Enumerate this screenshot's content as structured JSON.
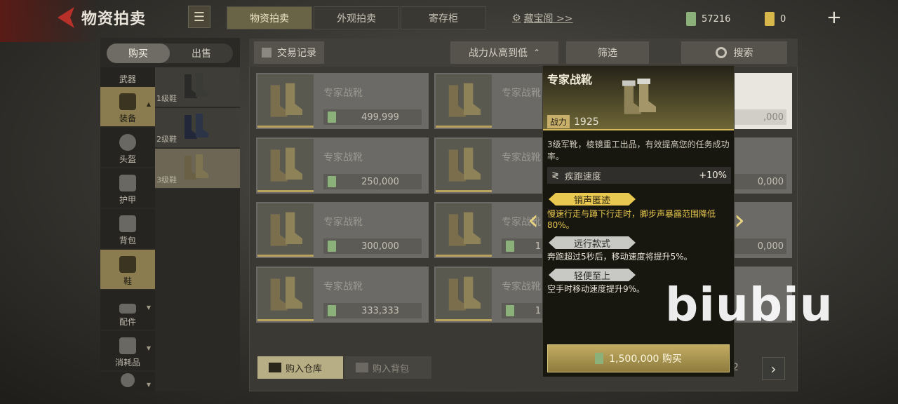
{
  "header": {
    "title": "物资拍卖",
    "tabs": [
      "物资拍卖",
      "外观拍卖",
      "寄存柜"
    ],
    "active_tab": 0,
    "treasure_link": "藏宝阁 >>",
    "currency_green": "57216",
    "currency_gold": "0",
    "plus": "+"
  },
  "sidebar": {
    "segment": [
      "购买",
      "出售"
    ],
    "categories": [
      {
        "label": "武器",
        "icon": "rifle-icon"
      },
      {
        "label": "装备",
        "icon": "vest-icon",
        "expand": "▲"
      },
      {
        "label": "头盔",
        "icon": "helmet-icon"
      },
      {
        "label": "护甲",
        "icon": "armor-icon"
      },
      {
        "label": "背包",
        "icon": "backpack-icon"
      },
      {
        "label": "鞋",
        "icon": "boot-icon"
      },
      {
        "label": "配件",
        "icon": "attachment-icon",
        "expand": "▼"
      },
      {
        "label": "消耗品",
        "icon": "consumable-icon",
        "expand": "▼"
      },
      {
        "label": "",
        "icon": "gear-icon",
        "expand": "▼"
      }
    ],
    "subitems": [
      "1级鞋",
      "2级鞋",
      "3级鞋"
    ]
  },
  "toolbar": {
    "history": "交易记录",
    "sort": "战力从高到低",
    "filter": "筛选",
    "search": "搜索"
  },
  "items": [
    {
      "name": "专家战靴",
      "price": "499,999"
    },
    {
      "name": "专家战靴",
      "price": ""
    },
    {
      "name": "专家战靴",
      "price": "250,000"
    },
    {
      "name": "专家战靴",
      "price": ""
    },
    {
      "name": "专家战靴",
      "price": "300,000"
    },
    {
      "name": "专家战靴",
      "price": "1"
    },
    {
      "name": "专家战靴",
      "price": "333,333"
    },
    {
      "name": "专家战靴",
      "price": "1"
    }
  ],
  "right_edge_prices": [
    ",000",
    "0,000",
    "0,000"
  ],
  "bottom": {
    "to_warehouse": "购入仓库",
    "to_backpack": "购入背包",
    "page_fragment": "2",
    "next": "›"
  },
  "detail": {
    "title": "专家战靴",
    "power_label": "战力",
    "power_value": "1925",
    "description": "3级军靴，棱镜重工出品，有效提高您的任务成功率。",
    "stat_label": "疾跑速度",
    "stat_value": "+10%",
    "perks": [
      {
        "name": "销声匿迹",
        "style": "gold",
        "text": "慢速行走与蹲下行走时，脚步声暴露范围降低80%。"
      },
      {
        "name": "远行款式",
        "style": "silver",
        "text": "奔跑超过5秒后，移动速度将提升5%。"
      },
      {
        "name": "轻便至上",
        "style": "silver",
        "text": "空手时移动速度提升9%。"
      }
    ],
    "buy_label": "1,500,000 购买",
    "prev": "‹",
    "next": "›"
  },
  "watermark": "biubiu",
  "colors": {
    "accent_gold": "#d6bc5a",
    "currency_green": "#8bb07a",
    "active_category": "#8a7c4e"
  }
}
